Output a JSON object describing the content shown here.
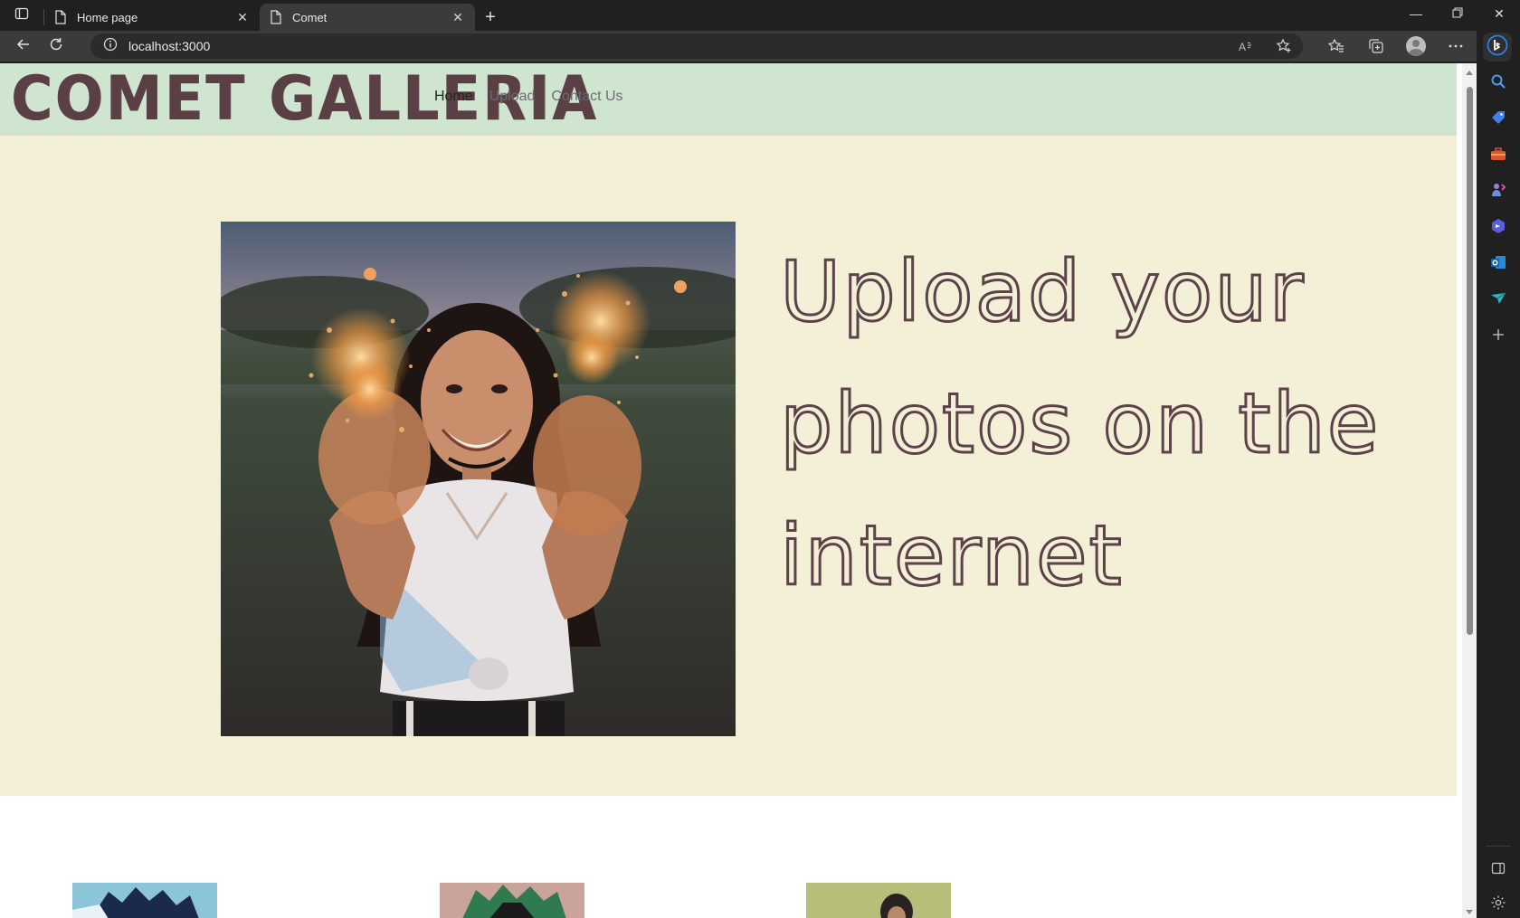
{
  "browser": {
    "tabs": [
      {
        "title": "Home page",
        "active": false
      },
      {
        "title": "Comet",
        "active": true
      }
    ],
    "address": "localhost:3000"
  },
  "site": {
    "brand": "COMET GALLERIA",
    "nav": [
      {
        "label": "Home",
        "active": true
      },
      {
        "label": "Upload",
        "active": false
      },
      {
        "label": "Contact Us",
        "active": false
      }
    ],
    "hero": {
      "headline": "Upload your photos on the internet"
    }
  },
  "colors": {
    "nav_bg": "#cfe5d0",
    "hero_bg": "#f4efd7",
    "brand": "#5a3f45"
  },
  "icons": [
    "sidebar-toggle-icon",
    "page-icon",
    "close-icon",
    "plus-icon",
    "minimize-icon",
    "restore-icon",
    "back-icon",
    "refresh-icon",
    "info-icon",
    "read-aloud-icon",
    "add-favorite-icon",
    "favorites-icon",
    "collections-icon",
    "profile-icon",
    "more-icon",
    "bing-icon",
    "search-icon",
    "shopping-icon",
    "tools-icon",
    "games-icon",
    "office-icon",
    "outlook-icon",
    "drop-icon",
    "split-screen-icon",
    "settings-icon"
  ]
}
